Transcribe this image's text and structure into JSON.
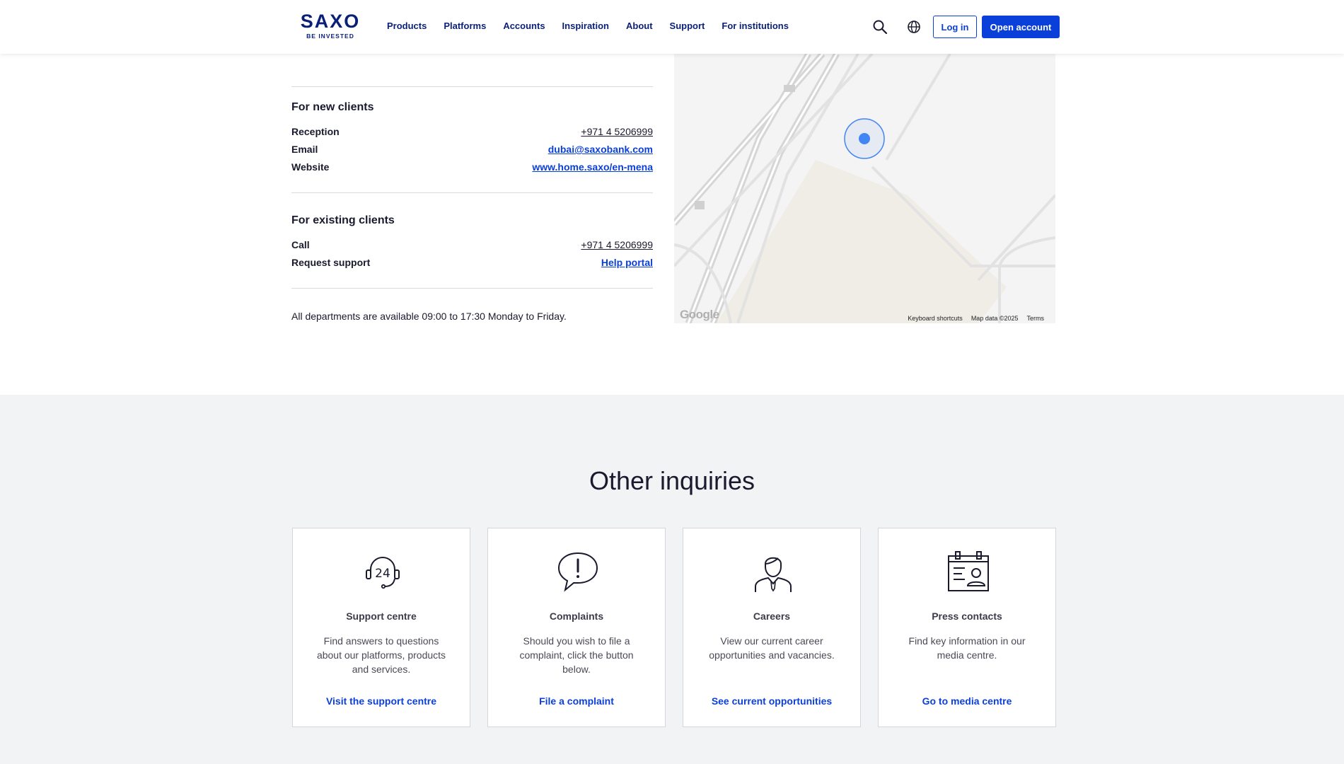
{
  "header": {
    "logo_main": "SAXO",
    "logo_sub": "BE INVESTED",
    "nav": [
      "Products",
      "Platforms",
      "Accounts",
      "Inspiration",
      "About",
      "Support",
      "For institutions"
    ],
    "login_label": "Log in",
    "open_account_label": "Open account"
  },
  "contact": {
    "new_clients": {
      "title": "For new clients",
      "rows": [
        {
          "label": "Reception",
          "value": "+971 4 5206999"
        },
        {
          "label": "Email",
          "value": "dubai@saxobank.com"
        },
        {
          "label": "Website",
          "value": "www.home.saxo/en-mena"
        }
      ]
    },
    "existing_clients": {
      "title": "For existing clients",
      "rows": [
        {
          "label": "Call",
          "value": "+971 4 5206999"
        },
        {
          "label": "Request support",
          "value": "Help portal"
        }
      ]
    },
    "hours": "All departments are available 09:00 to 17:30 Monday to Friday."
  },
  "map": {
    "google_label": "Google",
    "keyboard_shortcuts": "Keyboard shortcuts",
    "map_data": "Map data ©2025",
    "terms": "Terms",
    "marker_color": "#4285f4"
  },
  "other": {
    "title": "Other inquiries",
    "cards": [
      {
        "icon": "headset-24-icon",
        "title": "Support centre",
        "desc": "Find answers to questions about our platforms, products and services.",
        "link": "Visit the support centre"
      },
      {
        "icon": "speech-bubble-exclamation-icon",
        "title": "Complaints",
        "desc": "Should you wish to file a complaint, click the button below.",
        "link": "File a complaint"
      },
      {
        "icon": "person-icon",
        "title": "Careers",
        "desc": "View our current career opportunities and vacancies.",
        "link": "See current opportunities"
      },
      {
        "icon": "press-card-icon",
        "title": "Press contacts",
        "desc": "Find key information in our media centre.",
        "link": "Go to media centre"
      }
    ]
  },
  "colors": {
    "brand_navy": "#0a1f78",
    "accent_blue": "#0b3fd9",
    "section_bg": "#f2f3f5"
  }
}
